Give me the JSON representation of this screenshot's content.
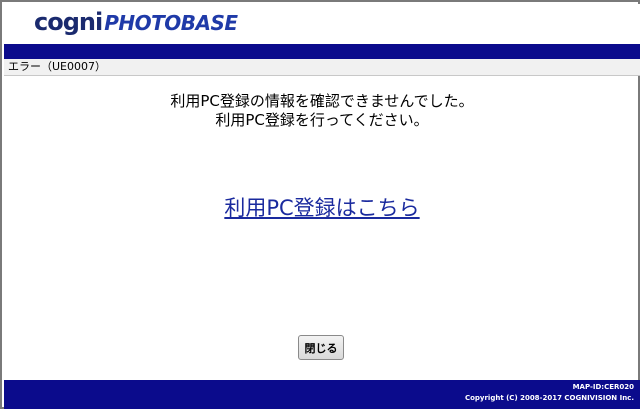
{
  "header": {
    "logo_cogni": "cogni",
    "logo_photobase": "PHOTOBASE"
  },
  "error_bar": {
    "title": "エラー（UE0007）"
  },
  "message": {
    "line1": "利用PC登録の情報を確認できませんでした。",
    "line2": "利用PC登録を行ってください。"
  },
  "register_link": {
    "label": "利用PC登録はこちら"
  },
  "close_button": {
    "label": "閉じる"
  },
  "footer": {
    "map_id": "MAP-ID:CER020",
    "copyright": "Copyright (C) 2008-2017 COGNIVISION Inc."
  },
  "colors": {
    "bar_navy": "#0b0b8c",
    "link_blue": "#1a2a9e",
    "logo_dark": "#1a2a6e",
    "logo_blue": "#1f3aa8"
  }
}
